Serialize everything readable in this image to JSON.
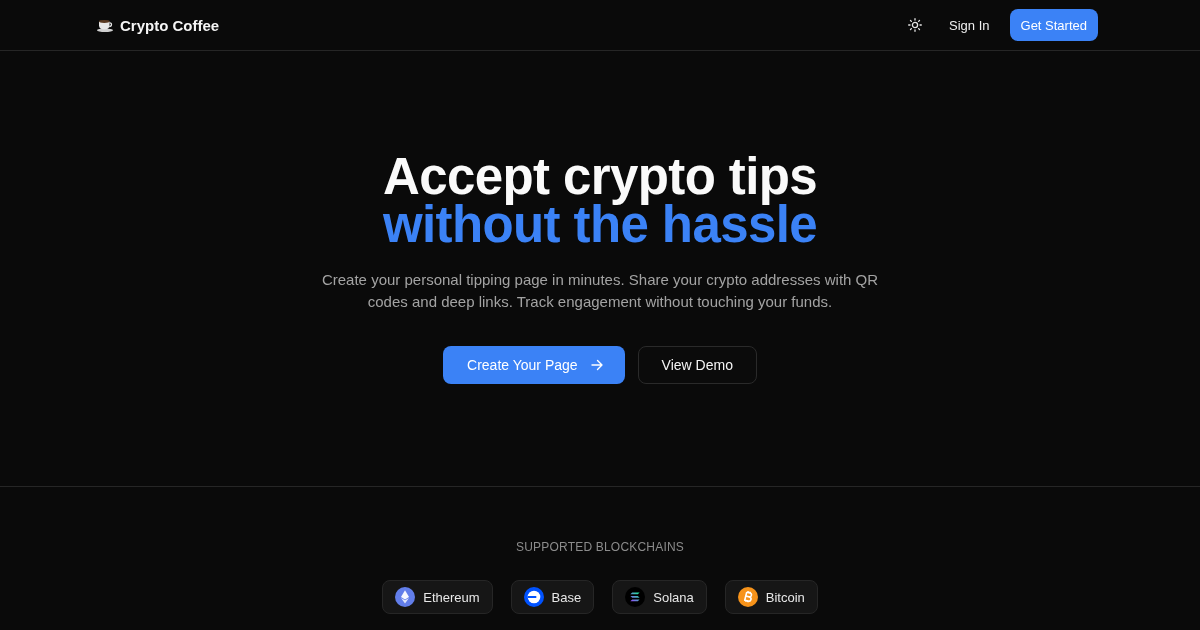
{
  "header": {
    "logo": "Crypto Coffee",
    "nav": [
      {
        "label": "Sign In",
        "kind": "link"
      },
      {
        "label": "Get Started",
        "kind": "primary"
      }
    ]
  },
  "hero": {
    "title": "Accept crypto tips",
    "title_highlight": "without the hassle",
    "subtitle": "Create your personal tipping page in minutes. Share your crypto addresses with QR codes and deep links. Track engagement without touching your funds.",
    "actions": [
      {
        "label": "Create Your Page",
        "kind": "primary"
      },
      {
        "label": "View Demo",
        "kind": "secondary"
      }
    ]
  },
  "blockchains": {
    "heading": "SUPPORTED BLOCKCHAINS",
    "items": [
      {
        "name": "Ethereum",
        "kind": "ethereum",
        "color": "#627eea"
      },
      {
        "name": "Base",
        "kind": "base",
        "color": "#0052ff"
      },
      {
        "name": "Solana",
        "kind": "solana",
        "color": "#000000"
      },
      {
        "name": "Bitcoin",
        "kind": "bitcoin",
        "color": "#f7931a"
      }
    ]
  }
}
